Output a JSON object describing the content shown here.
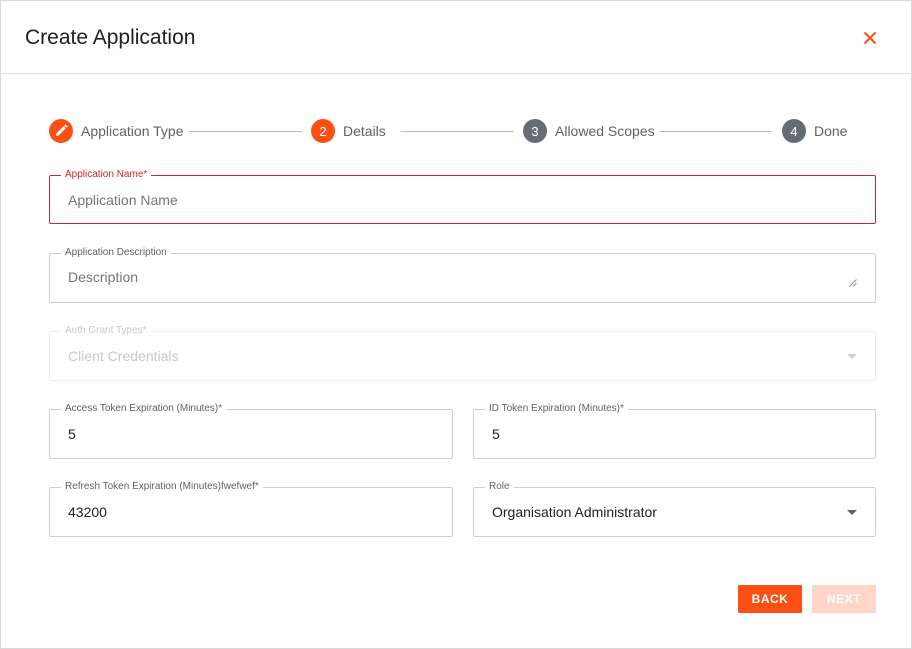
{
  "dialog": {
    "title": "Create Application"
  },
  "stepper": {
    "steps": [
      {
        "label": "Application Type",
        "state": "completed",
        "icon": "pencil-icon"
      },
      {
        "label": "Details",
        "state": "active",
        "number": "2"
      },
      {
        "label": "Allowed Scopes",
        "state": "pending",
        "number": "3"
      },
      {
        "label": "Done",
        "state": "pending",
        "number": "4"
      }
    ]
  },
  "form": {
    "app_name": {
      "label": "Application Name*",
      "placeholder": "Application Name",
      "value": ""
    },
    "app_description": {
      "label": "Application Description",
      "placeholder": "Description",
      "value": ""
    },
    "auth_grant_types": {
      "label": "Auth Grant Types*",
      "value": "Client Credentials"
    },
    "access_token_exp": {
      "label": "Access Token Expiration (Minutes)*",
      "value": "5"
    },
    "id_token_exp": {
      "label": "ID Token Expiration (Minutes)*",
      "value": "5"
    },
    "refresh_token_exp": {
      "label": "Refresh Token Expiration (Minutes)fwefwef*",
      "value": "43200"
    },
    "role": {
      "label": "Role",
      "value": "Organisation Administrator"
    }
  },
  "actions": {
    "back_label": "BACK",
    "next_label": "NEXT"
  },
  "colors": {
    "accent": "#fb4f14",
    "error": "#c62828",
    "step_pending": "#666c76",
    "next_disabled": "#ffd6c8"
  }
}
